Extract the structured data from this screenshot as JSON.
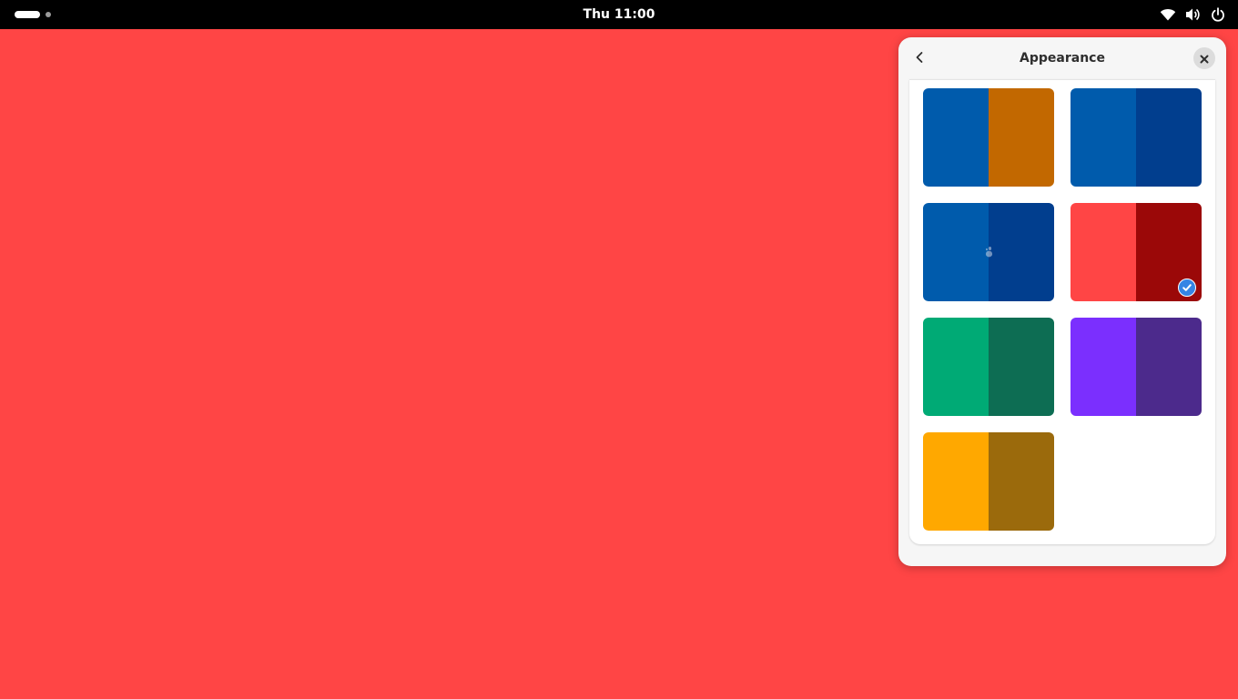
{
  "topbar": {
    "clock": "Thu 11:00",
    "workspaces": {
      "count": 2,
      "active": 1
    },
    "icons": [
      "wifi-icon",
      "volume-icon",
      "power-icon"
    ]
  },
  "desktop": {
    "background": "#ff4545"
  },
  "panel": {
    "title": "Appearance",
    "back_icon": "chevron-left-icon",
    "close_icon": "close-icon",
    "backgrounds": [
      {
        "left": "#005bac",
        "right": "#c26800",
        "selected": false
      },
      {
        "left": "#005bac",
        "right": "#013e8e",
        "selected": false
      },
      {
        "left": "#005bac",
        "right": "#013e8e",
        "selected": false,
        "logo": true
      },
      {
        "left": "#ff4545",
        "right": "#9b0808",
        "selected": true
      },
      {
        "left": "#00aa75",
        "right": "#0d6d53",
        "selected": false
      },
      {
        "left": "#7b2ffe",
        "right": "#4c2a8c",
        "selected": false
      },
      {
        "left": "#ffa800",
        "right": "#9b6a0c",
        "selected": false
      }
    ]
  }
}
